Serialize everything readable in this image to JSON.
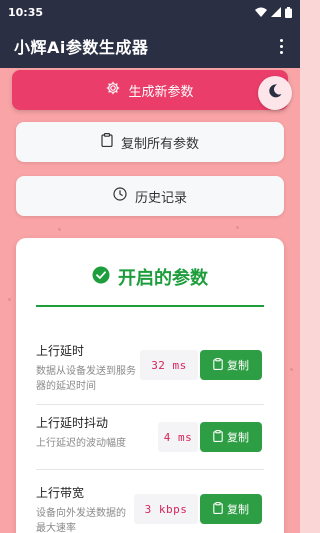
{
  "status_bar": {
    "time": "10:35"
  },
  "app_bar": {
    "title": "小辉Ai参数生成器"
  },
  "buttons": {
    "generate": "生成新参数",
    "copy_all": "复制所有参数",
    "history": "历史记录"
  },
  "card": {
    "title": "开启的参数",
    "params": [
      {
        "name": "上行延时",
        "desc": "数据从设备发送到服务器的延迟时间",
        "value": "32 ms",
        "copy_label": "复制"
      },
      {
        "name": "上行延时抖动",
        "desc": "上行延迟的波动幅度",
        "value": "4 ms",
        "copy_label": "复制"
      },
      {
        "name": "上行带宽",
        "desc": "设备向外发送数据的最大速率",
        "value": "3 kbps",
        "copy_label": "复制"
      }
    ]
  },
  "colors": {
    "app_bar": "#2a2f43",
    "background": "#f9a4a6",
    "primary_button": "#ea3d6a",
    "success": "#1e9d3c",
    "copy_button": "#2e9e44",
    "value_text": "#d6245a"
  },
  "icons": [
    "wifi-icon",
    "signal-icon",
    "battery-icon",
    "more-vert-icon",
    "gear-icon",
    "clipboard-icon",
    "clock-icon",
    "moon-icon",
    "check-circle-icon"
  ]
}
